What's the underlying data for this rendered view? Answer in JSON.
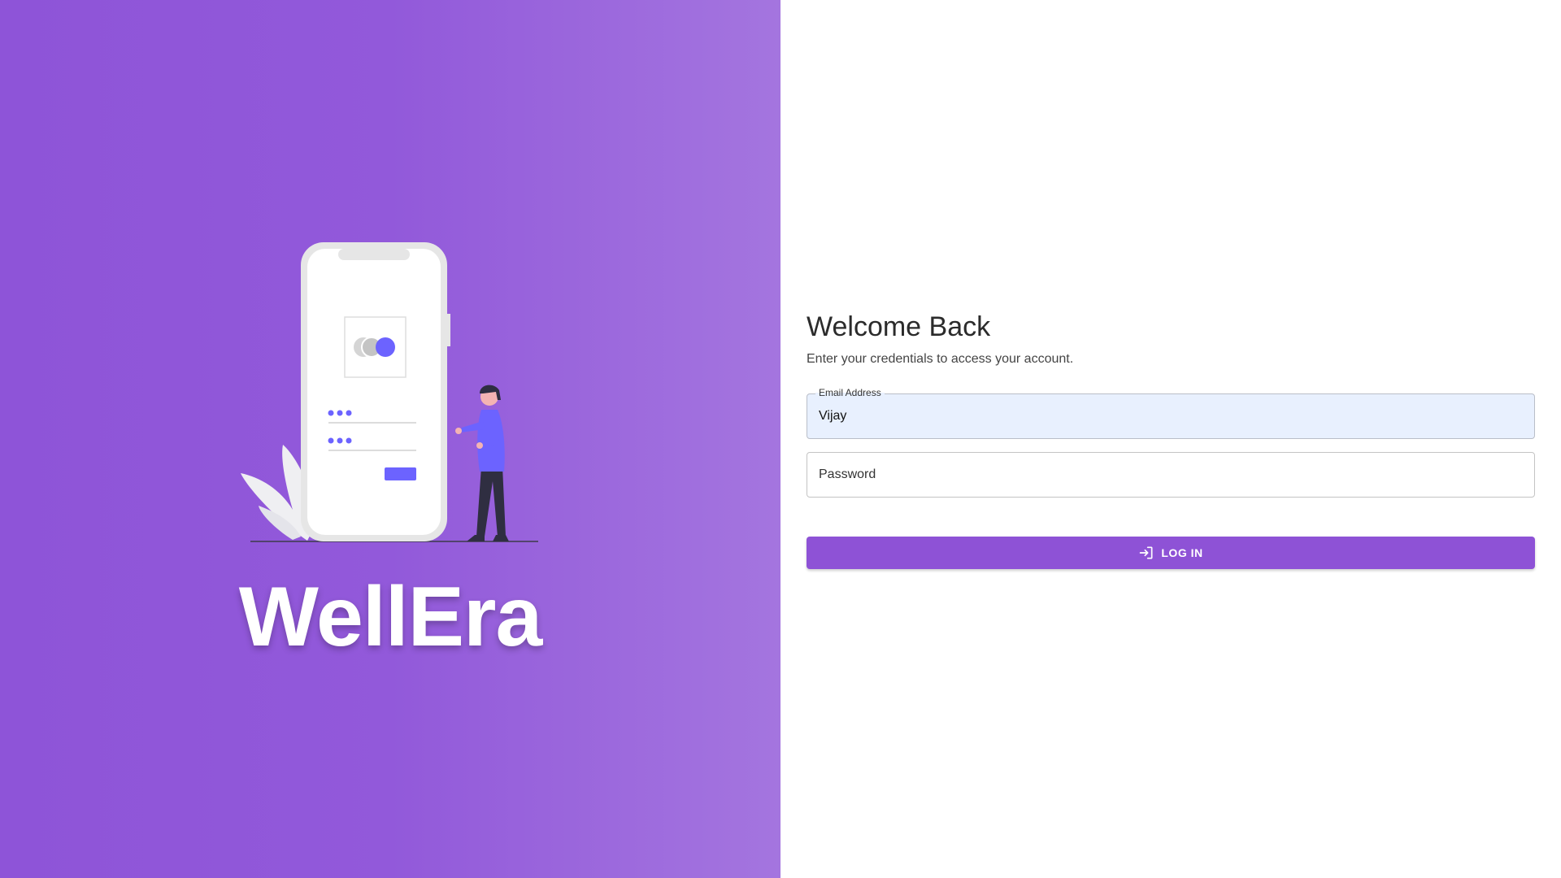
{
  "brand": {
    "name": "WellEra",
    "background_color": "#8e54d8"
  },
  "login": {
    "title": "Welcome Back",
    "subtitle": "Enter your credentials to access your account.",
    "email": {
      "label": "Email Address",
      "value": "Vijay"
    },
    "password": {
      "placeholder": "Password",
      "value": ""
    },
    "button": {
      "label": "LOG IN",
      "icon": "login-icon",
      "color": "#8e52d6"
    }
  },
  "illustration": {
    "icon": "phone-login-illustration"
  }
}
